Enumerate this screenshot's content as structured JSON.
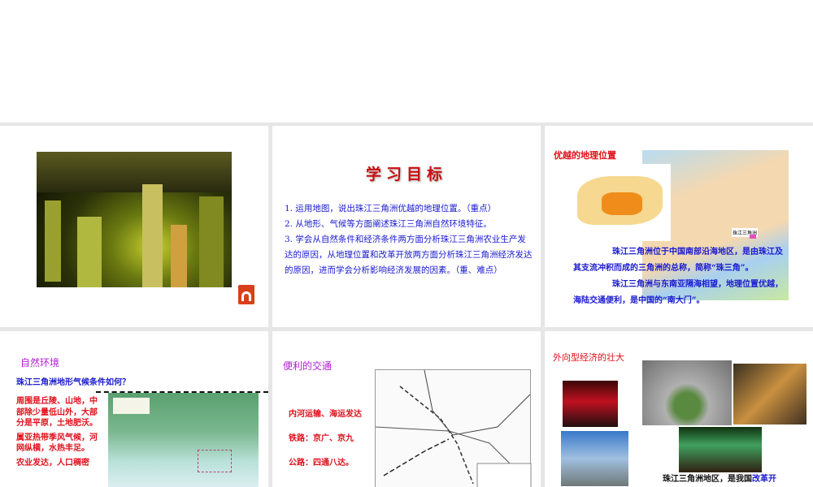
{
  "slides": [
    {
      "type": "photo",
      "audio_icon": "audio-file-icon"
    },
    {
      "title": "学习目标",
      "items": [
        "1. 运用地图，说出珠江三角洲优越的地理位置。（重点）",
        "2. 从地形、气候等方面阐述珠江三角洲自然环境特征。",
        "3. 学会从自然条件和经济条件两方面分析珠江三角洲农业生产发达的原因，从地理位置和改革开放两方面分析珠江三角洲经济发达的原因，进而学会分析影响经济发展的因素。（重、难点）"
      ]
    },
    {
      "title": "优越的地理位置",
      "map_label": "珠江三角洲",
      "para1": "珠江三角洲位于中国南部沿海地区，是由珠江及其支流冲积而成的三角洲的总称，简称“珠三角”。",
      "para2": "珠江三角洲与东南亚隔海相望，地理位置优越，海陆交通便利，是中国的“南大门”。"
    },
    {
      "title": "自然环境",
      "question": "珠江三角洲地形气候条件如何？",
      "points": [
        "周围是丘陵、山地，中部除少量低山外，大部分是平原，土地肥沃。",
        "属亚热带季风气候，河网纵横，水热丰足。",
        "农业发达，人口稠密"
      ]
    },
    {
      "title": "便利的交通",
      "points": [
        "内河运输、海运发达",
        "铁路：京广、京九",
        "公路：四通八达。"
      ]
    },
    {
      "title": "外向型经济的壮大",
      "caption_a": "珠江三角洲地区，是我国",
      "caption_b": "改革开"
    }
  ]
}
